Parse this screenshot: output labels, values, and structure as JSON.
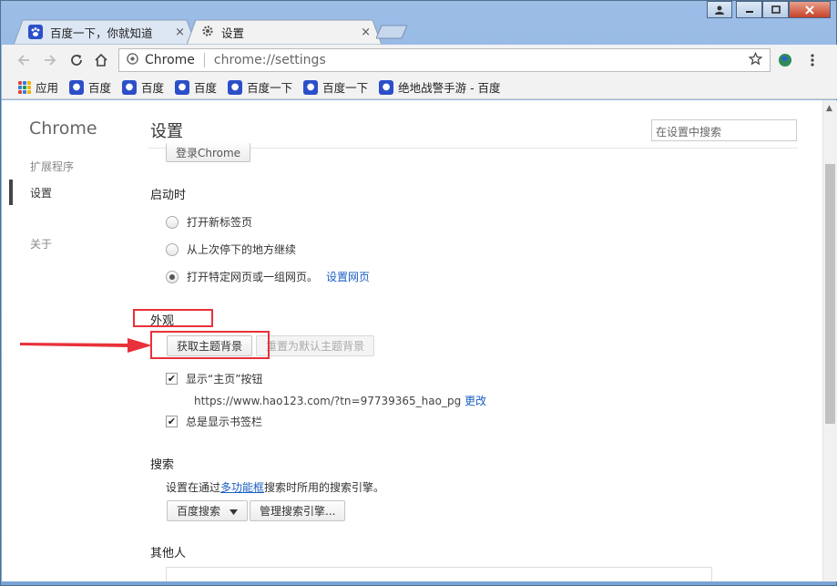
{
  "window": {
    "colors": {
      "close": "#c7432b",
      "frame": "#7aa3d6"
    }
  },
  "tabs": [
    {
      "title": "百度一下，你就知道",
      "icon": "baidu-paw-icon",
      "close": "×"
    },
    {
      "title": "设置",
      "icon": "gear-icon",
      "close": "×"
    }
  ],
  "toolbar": {
    "omnibox_site": "Chrome",
    "omnibox_url": "chrome://settings"
  },
  "bookmarks": [
    {
      "label": "应用",
      "icon": "apps-grid-icon"
    },
    {
      "label": "百度",
      "icon": "baidu-paw-icon"
    },
    {
      "label": "百度",
      "icon": "baidu-paw-icon"
    },
    {
      "label": "百度",
      "icon": "baidu-paw-icon"
    },
    {
      "label": "百度一下",
      "icon": "baidu-paw-icon"
    },
    {
      "label": "百度一下",
      "icon": "baidu-paw-icon"
    },
    {
      "label": "绝地战警手游 - 百度",
      "icon": "baidu-paw-icon"
    }
  ],
  "sidebar": {
    "brand": "Chrome",
    "items": [
      {
        "label": "扩展程序",
        "active": false
      },
      {
        "label": "设置",
        "active": true
      },
      {
        "label": "关于",
        "active": false
      }
    ]
  },
  "main": {
    "title": "设置",
    "search_placeholder": "在设置中搜索",
    "signin_button": "登录Chrome",
    "startup": {
      "title": "启动时",
      "options": [
        {
          "label": "打开新标签页",
          "selected": false
        },
        {
          "label": "从上次停下的地方继续",
          "selected": false
        },
        {
          "label": "打开特定网页或一组网页。",
          "selected": true,
          "link": "设置网页"
        }
      ]
    },
    "appearance": {
      "title": "外观",
      "get_theme_button": "获取主题背景",
      "reset_theme_button": "重置为默认主题背景",
      "show_home": {
        "label": "显示“主页”按钮",
        "checked": true
      },
      "home_url": "https://www.hao123.com/?tn=97739365_hao_pg",
      "home_change_link": "更改",
      "show_bookmarks": {
        "label": "总是显示书签栏",
        "checked": true
      }
    },
    "search": {
      "title": "搜索",
      "desc_prefix": "设置在通过",
      "desc_link": "多功能框",
      "desc_suffix": "搜索时所用的搜索引擎。",
      "engine_select": "百度搜索",
      "manage_button": "管理搜索引擎..."
    },
    "people": {
      "title": "其他人"
    }
  },
  "annotations": {
    "color": "#e8313a"
  }
}
